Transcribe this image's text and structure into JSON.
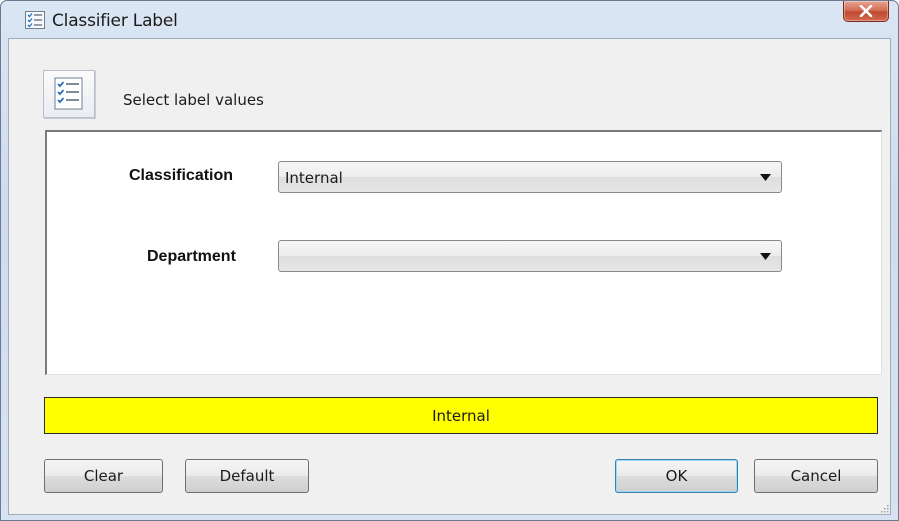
{
  "window": {
    "title": "Classifier Label",
    "icon": "checklist-icon"
  },
  "header": {
    "text": "Select label values",
    "icon": "checklist-icon"
  },
  "fields": [
    {
      "label": "Classification",
      "value": "Internal"
    },
    {
      "label": "Department",
      "value": ""
    }
  ],
  "status": {
    "text": "Internal",
    "color": "#ffff00"
  },
  "buttons": {
    "clear": "Clear",
    "default": "Default",
    "ok": "OK",
    "cancel": "Cancel"
  },
  "colors": {
    "close_button": "#c8503a",
    "status_background": "#ffff00",
    "focus_border": "#3c7fb1"
  }
}
